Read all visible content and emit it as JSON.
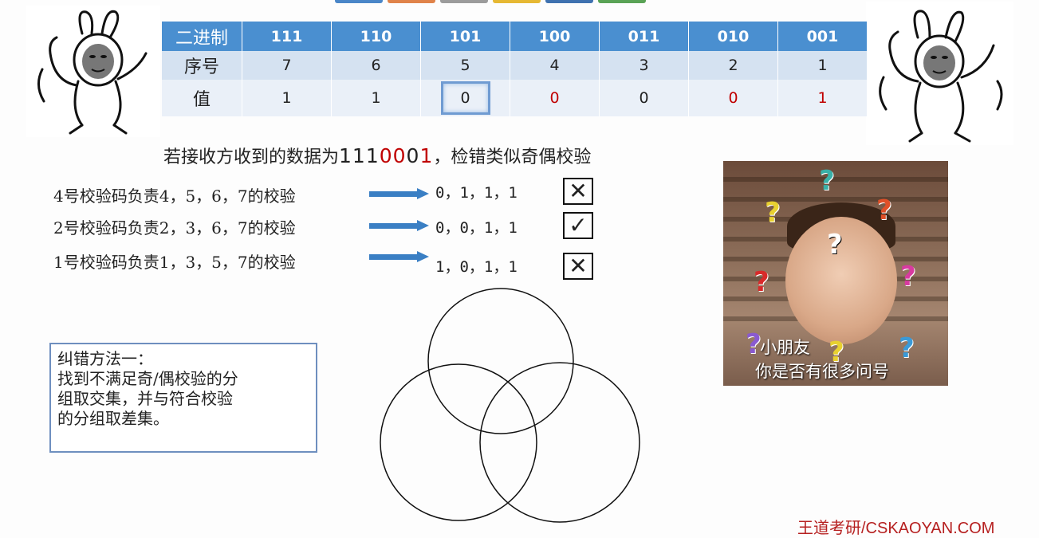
{
  "top_accent_colors": [
    "#4a86c8",
    "#e0834a",
    "#9c9c9c",
    "#e6b833",
    "#3f72b0",
    "#5aa356"
  ],
  "table": {
    "row_headers": [
      "二进制",
      "序号",
      "值"
    ],
    "binary": [
      "111",
      "110",
      "101",
      "100",
      "011",
      "010",
      "001"
    ],
    "index": [
      "7",
      "6",
      "5",
      "4",
      "3",
      "2",
      "1"
    ],
    "values": [
      "1",
      "1",
      "0",
      "0",
      "0",
      "0",
      "1"
    ]
  },
  "caption": {
    "prefix": "若接收方收到的数据为",
    "data_part1": "111",
    "data_part2": "00",
    "data_part3": "0",
    "data_part4": "1",
    "suffix": "，检错类似奇偶校验"
  },
  "checks": [
    {
      "text": "4号校验码负责4，5，6，7的校验",
      "values": "0，1，1，1",
      "mark": "✕"
    },
    {
      "text": "2号校验码负责2，3，6，7的校验",
      "values": "0，0，1，1",
      "mark": "✓"
    },
    {
      "text": "1号校验码负责1，3，5，7的校验",
      "values": "1，0，1，1",
      "mark": "✕"
    }
  ],
  "note": {
    "lines": [
      "纠错方法一：",
      "找到不满足奇/偶校验的分",
      "组取交集，并与符合校验",
      "的分组取差集。"
    ]
  },
  "photo": {
    "caption_line1": "小朋友",
    "caption_line2": "你是否有很多问号",
    "question_mark": "?"
  },
  "brand": "王道考研/CSKAOYAN.COM",
  "colors": {
    "table_header": "#4a8fd0",
    "error_red": "#c00000",
    "brand_red": "#b62020",
    "arrow_blue": "#3a7fc4"
  }
}
